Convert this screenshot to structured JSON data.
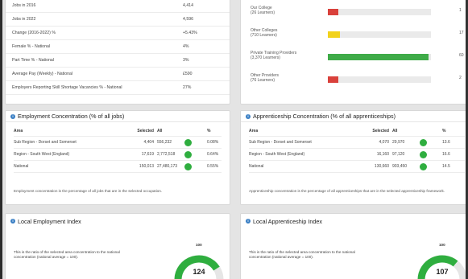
{
  "stats": [
    {
      "label": "Jobs in 2016",
      "value": "4,414"
    },
    {
      "label": "Jobs in 2022",
      "value": "4,596"
    },
    {
      "label": "Change (2016-2022) %",
      "value": "+5.43%"
    },
    {
      "label": "Female % - National",
      "value": "4%"
    },
    {
      "label": "Part Time % - National",
      "value": "3%"
    },
    {
      "label": "Average Pay (Weekly) - National",
      "value": "£590"
    },
    {
      "label": "Employers Reporting Skill Shortage Vacancies % - National",
      "value": "27%"
    }
  ],
  "providers": [
    {
      "label": "Our College",
      "sub": "(26 Learners)",
      "value": "1",
      "fraction": 0.1,
      "color": "#d9413b"
    },
    {
      "label": "Other Colleges",
      "sub": "(710 Learners)",
      "value": "17",
      "fraction": 0.12,
      "color": "#f2d21c"
    },
    {
      "label": "Private Training Providers",
      "sub": "(3,370 Learners)",
      "value": "60",
      "fraction": 0.98,
      "color": "#3fab48"
    },
    {
      "label": "Other Providers",
      "sub": "(76 Learners)",
      "value": "2",
      "fraction": 0.1,
      "color": "#d9413b"
    }
  ],
  "employment": {
    "title": "Employment Concentration (% of all jobs)",
    "headers": {
      "area": "Area",
      "selected": "Selected",
      "all": "All",
      "pct": "%"
    },
    "rows": [
      {
        "area": "Sub Region - Dorset and Somerset",
        "selected": "4,404",
        "all": "556,232",
        "pct": "0.08%"
      },
      {
        "area": "Region - South West (England)",
        "selected": "17,619",
        "all": "2,772,518",
        "pct": "0.64%"
      },
      {
        "area": "National",
        "selected": "150,013",
        "all": "27,480,173",
        "pct": "0.55%"
      }
    ],
    "note": "Employment concentration is the percentage of all jobs that are in the selected occupation."
  },
  "apprenticeship": {
    "title": "Apprenticeship Concentration (% of all apprenticeships)",
    "headers": {
      "area": "Area",
      "selected": "Selected",
      "all": "All",
      "pct": "%"
    },
    "rows": [
      {
        "area": "Sub Region - Dorset and Somerset",
        "selected": "4,070",
        "all": "29,970",
        "pct": "13.6"
      },
      {
        "area": "Region - South West (England)",
        "selected": "16,160",
        "all": "97,120",
        "pct": "16.6"
      },
      {
        "area": "National",
        "selected": "130,660",
        "all": "903,450",
        "pct": "14.5"
      }
    ],
    "note": "Apprenticeship concentration is the percentage of all apprenticeships that are in the selected apprenticeship framework."
  },
  "local_employment": {
    "title": "Local Employment Index",
    "desc": "This is the ratio of the selected area concentration to the national concentration (national average = 100).",
    "max": "100",
    "value": "124",
    "fraction": 0.82
  },
  "local_apprenticeship": {
    "title": "Local Apprenticeship Index",
    "desc": "This is the ratio of the selected area concentration to the national concentration (national average = 100).",
    "max": "100",
    "value": "107",
    "fraction": 0.72
  },
  "colors": {
    "green": "#2fae3f",
    "info": "#3a7fc4",
    "track": "#e6e6e6"
  }
}
